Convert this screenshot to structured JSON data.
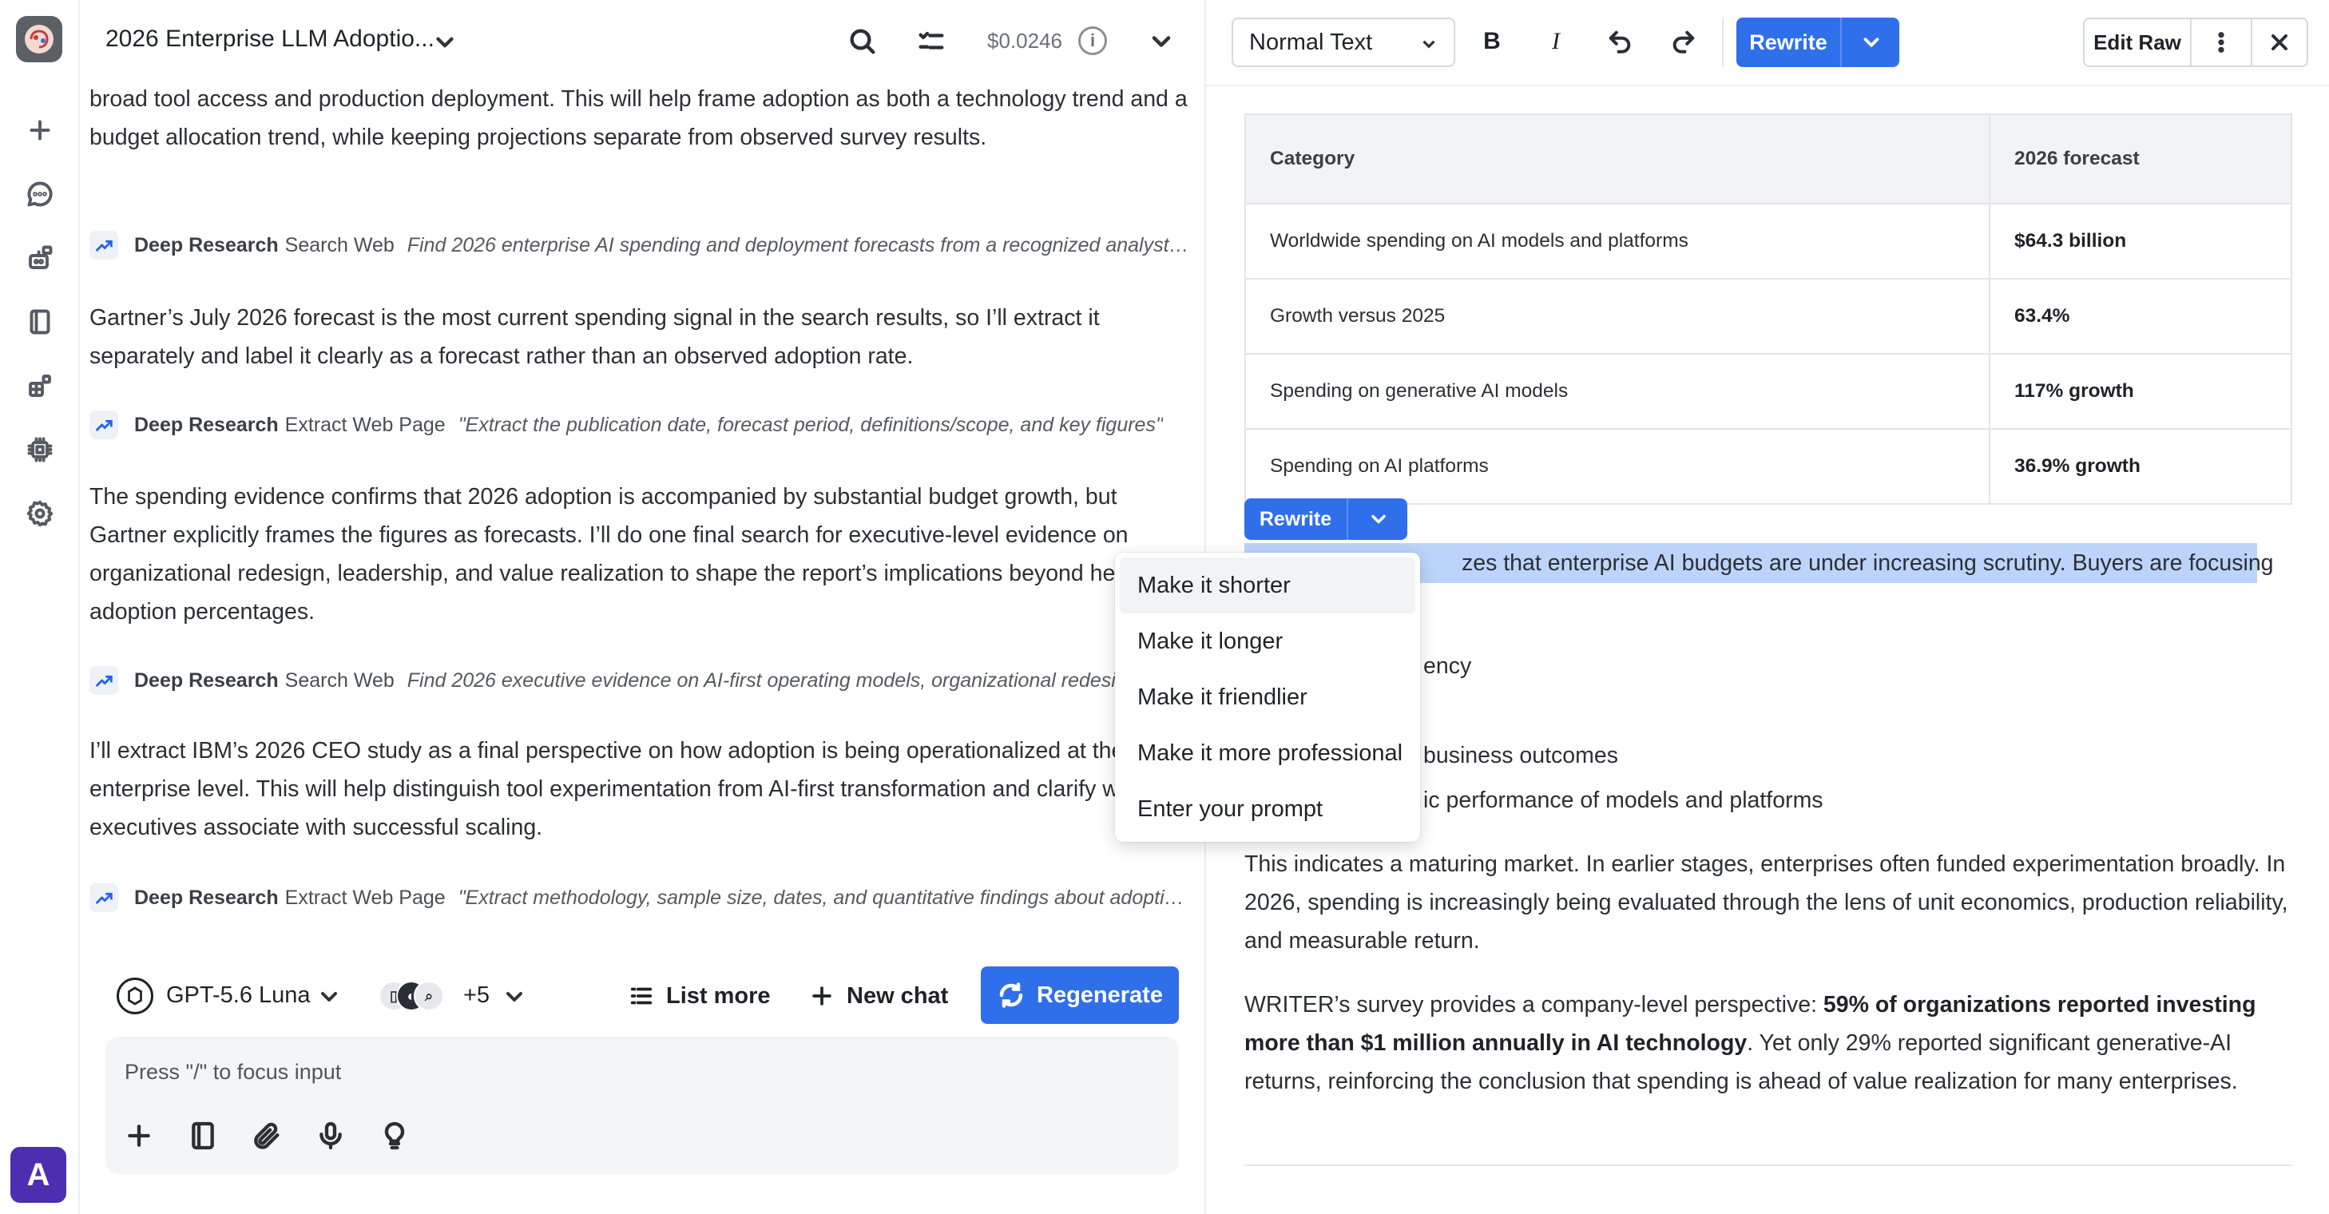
{
  "app": {
    "avatar_letter": "A"
  },
  "rail": {
    "items": [
      {
        "icon": "plus-icon"
      },
      {
        "icon": "chat-bubble-icon"
      },
      {
        "icon": "agents-icon"
      },
      {
        "icon": "notebook-icon"
      },
      {
        "icon": "apps-icon"
      },
      {
        "icon": "chip-icon"
      },
      {
        "icon": "gear-icon"
      }
    ]
  },
  "chat": {
    "title": "2026 Enterprise LLM Adoptio...",
    "cost": "$0.0246",
    "info_glyph": "i",
    "paragraphs": [
      "broad tool access and production deployment. This will help frame adoption as both a technology trend and a budget allocation trend, while keeping projections separate from observed survey results.",
      "Gartner’s July 2026 forecast is the most current spending signal in the search results, so I’ll extract it separately and label it clearly as a forecast rather than an observed adoption rate.",
      "The spending evidence confirms that 2026 adoption is accompanied by substantial budget growth, but Gartner explicitly frames the figures as forecasts. I’ll do one final search for executive-level evidence on organizational redesign, leadership, and value realization to shape the report’s implications beyond headline adoption percentages.",
      "I’ll extract IBM’s 2026 CEO study as a final perspective on how adoption is being operationalized at the enterprise level. This will help distinguish tool experimentation from AI-first transformation and clarify what executives associate with successful scaling."
    ],
    "tool_calls": [
      {
        "name": "Deep Research",
        "action": "Search Web",
        "query": "Find 2026 enterprise AI spending and deployment forecasts from a recognized analyst firm"
      },
      {
        "name": "Deep Research",
        "action": "Extract Web Page",
        "query": "\"Extract the publication date, forecast period, definitions/scope, and key figures\""
      },
      {
        "name": "Deep Research",
        "action": "Search Web",
        "query": "Find 2026 executive evidence on AI-first operating models, organizational redesign"
      },
      {
        "name": "Deep Research",
        "action": "Extract Web Page",
        "query": "\"Extract methodology, sample size, dates, and quantitative findings about adoption\""
      }
    ],
    "model": "GPT-5.6 Luna",
    "tools_extra": "+5",
    "list_more": "List more",
    "new_chat": "New chat",
    "regenerate": "Regenerate",
    "input_placeholder": "Press \"/\" to focus input"
  },
  "editor": {
    "style_select": "Normal Text",
    "bold": "B",
    "italic": "I",
    "rewrite": "Rewrite",
    "edit_raw": "Edit Raw",
    "table": {
      "headers": [
        "Category",
        "2026 forecast"
      ],
      "rows": [
        [
          "Worldwide spending on AI models and platforms",
          "$64.3 billion"
        ],
        [
          "Growth versus 2025",
          "63.4%"
        ],
        [
          "Spending on generative AI models",
          "117% growth"
        ],
        [
          "Spending on AI platforms",
          "36.9% growth"
        ]
      ]
    },
    "selected_text": "This emphasizes that enterprise AI budgets are under increasing scrutiny. Buyers are focusing",
    "selected_visible": "zes that enterprise AI budgets are under increasing scrutiny. Buyers are focusing",
    "bullet_fragments": [
      "ency",
      "business outcomes",
      "ic performance of models and platforms"
    ],
    "paragraph_1": "This indicates a maturing market. In earlier stages, enterprises often funded experimentation broadly. In 2026, spending is increasingly being evaluated through the lens of unit economics, production reliability, and measurable return.",
    "paragraph_2_pre": "WRITER’s survey provides a company-level perspective: ",
    "paragraph_2_bold": "59% of organizations reported investing more than $1 million annually in AI technology",
    "paragraph_2_post": ". Yet only 29% reported significant generative-AI returns, reinforcing the conclusion that spending is ahead of value realization for many enterprises.",
    "rewrite_menu": [
      "Make it shorter",
      "Make it longer",
      "Make it friendlier",
      "Make it more professional",
      "Enter your prompt"
    ]
  },
  "colors": {
    "accent": "#2f6fea",
    "selection": "#bcd4f9",
    "avatar": "#4b2fb0"
  }
}
